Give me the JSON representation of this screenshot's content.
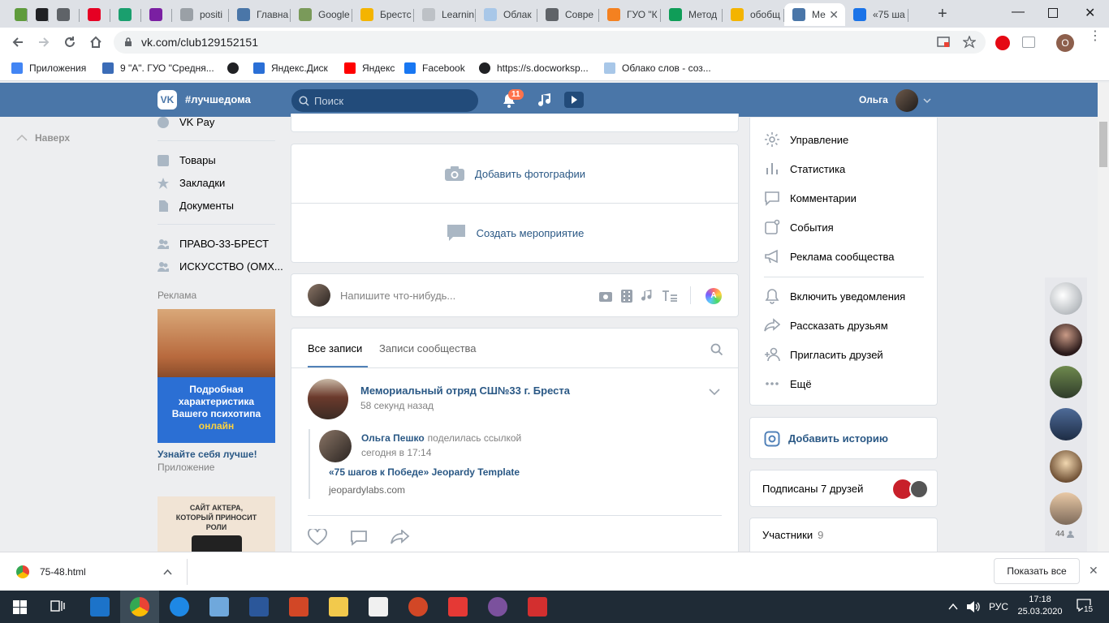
{
  "browser": {
    "tabs": [
      {
        "label": "",
        "color": "#5f9b3c"
      },
      {
        "label": "",
        "color": "#202124"
      },
      {
        "label": "",
        "color": "#5f6368"
      },
      {
        "label": "",
        "color": "#e60023"
      },
      {
        "label": "",
        "color": "#1a9f6e"
      },
      {
        "label": "",
        "color": "#7a1fa2"
      },
      {
        "label": "positi",
        "color": "#9aa0a6"
      },
      {
        "label": "Главна",
        "color": "#4a76a8"
      },
      {
        "label": "Google",
        "color": "#7a9a5a"
      },
      {
        "label": "Брестс",
        "color": "#f4b400"
      },
      {
        "label": "Learnin",
        "color": "#bdc1c6"
      },
      {
        "label": "Облак",
        "color": "#a8c7e8"
      },
      {
        "label": "Совре",
        "color": "#5f6368"
      },
      {
        "label": "ГУО \"К",
        "color": "#f48120"
      },
      {
        "label": "Метод",
        "color": "#0f9d58"
      },
      {
        "label": "обобщ",
        "color": "#f4b400"
      },
      {
        "label": "Ме",
        "color": "#4a76a8"
      },
      {
        "label": "«75 ша",
        "color": "#1a73e8"
      }
    ],
    "active_tab_index": 16,
    "url": "vk.com/club129152151",
    "profile_initial": "O",
    "bookmarks": [
      {
        "label": "Приложения",
        "color": "#4285f4"
      },
      {
        "label": "9 \"А\". ГУО \"Средня...",
        "color": "#3b6cb7"
      },
      {
        "label": "",
        "color": "#202124"
      },
      {
        "label": "Яндекс.Диск",
        "color": "#2a6fd6"
      },
      {
        "label": "Яндекс",
        "color": "#ff0000"
      },
      {
        "label": "Facebook",
        "color": "#1877f2"
      },
      {
        "label": "https://s.docworksp...",
        "color": "#202124"
      },
      {
        "label": "Облако слов - соз...",
        "color": "#a8c7e8"
      }
    ]
  },
  "vk": {
    "hashtag": "#лучшедома",
    "search_placeholder": "Поиск",
    "notifications_count": "11",
    "user_name": "Ольга",
    "back_to_top": "Наверх",
    "left_menu": [
      {
        "label": "VK Pay",
        "icon": "vkpay-icon"
      },
      {
        "label": "Товары",
        "icon": "bag-icon"
      },
      {
        "label": "Закладки",
        "icon": "star-icon"
      },
      {
        "label": "Документы",
        "icon": "document-icon"
      },
      {
        "label": "ПРАВО-33-БРЕСТ",
        "icon": "group-icon"
      },
      {
        "label": "ИСКУССТВО (ОМХ...",
        "icon": "group-icon"
      }
    ],
    "ads": {
      "title": "Реклама",
      "ad1_banner_lines": [
        "Подробная",
        "характеристика",
        "Вашего психотипа",
        "онлайн"
      ],
      "ad1_title": "Узнайте себя лучше!",
      "ad1_subtitle": "Приложение",
      "ad2_lines": [
        "САЙТ АКТЕРА,",
        "КОТОРЫЙ ПРИНОСИТ",
        "РОЛИ"
      ]
    },
    "actions": {
      "add_photos": "Добавить фотографии",
      "create_event": "Создать мероприятие"
    },
    "composer_placeholder": "Напишите что-нибудь...",
    "feed_tabs": [
      "Все записи",
      "Записи сообщества"
    ],
    "post": {
      "author": "Мемориальный отряд СШ№33 г. Бреста",
      "time": "58 секунд назад",
      "shared_by": "Ольга Пешко",
      "shared_action": "поделилась ссылкой",
      "shared_time": "сегодня в 17:14",
      "link_title": "«75 шагов к Победе» Jeopardy Template",
      "link_domain": "jeopardylabs.com"
    },
    "right_menu": [
      {
        "label": "Управление",
        "icon": "gear-icon"
      },
      {
        "label": "Статистика",
        "icon": "stats-icon"
      },
      {
        "label": "Комментарии",
        "icon": "comment-icon"
      },
      {
        "label": "События",
        "icon": "events-icon"
      },
      {
        "label": "Реклама сообщества",
        "icon": "megaphone-icon"
      },
      {
        "label": "Включить уведомления",
        "icon": "bell-icon"
      },
      {
        "label": "Рассказать друзьям",
        "icon": "share-icon"
      },
      {
        "label": "Пригласить друзей",
        "icon": "add-friend-icon"
      },
      {
        "label": "Ещё",
        "icon": "more-icon"
      }
    ],
    "add_story": "Добавить историю",
    "friends_subscribed": "Подписаны 7 друзей",
    "members_label": "Участники",
    "members_count": "9",
    "online_count": "44"
  },
  "download": {
    "filename": "75-48.html",
    "show_all": "Показать все"
  },
  "taskbar": {
    "lang": "РУС",
    "time": "17:18",
    "date": "25.03.2020",
    "notifications": "15"
  }
}
